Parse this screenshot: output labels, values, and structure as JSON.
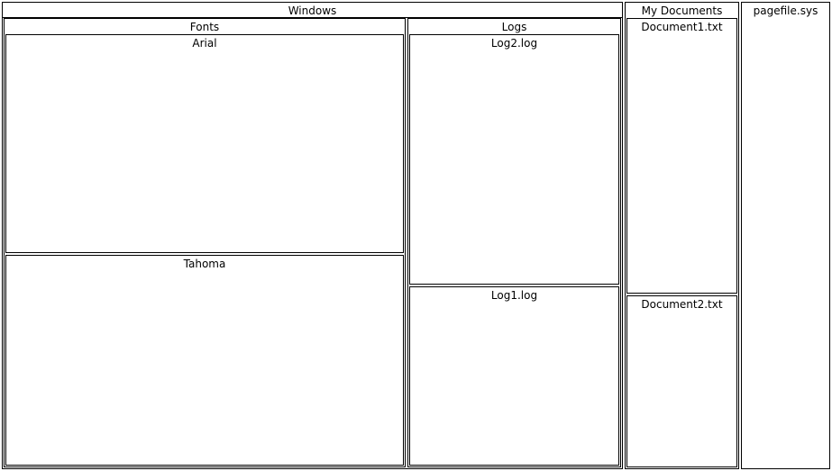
{
  "treemap": {
    "windows": {
      "label": "Windows",
      "fonts": {
        "label": "Fonts",
        "arial": "Arial",
        "tahoma": "Tahoma"
      },
      "logs": {
        "label": "Logs",
        "log2": "Log2.log",
        "log1": "Log1.log"
      }
    },
    "my_documents": {
      "label": "My Documents",
      "document1": "Document1.txt",
      "document2": "Document2.txt"
    },
    "pagefile": {
      "label": "pagefile.sys"
    }
  },
  "colors": {
    "border": "#000000",
    "fill": "#ffffff"
  }
}
